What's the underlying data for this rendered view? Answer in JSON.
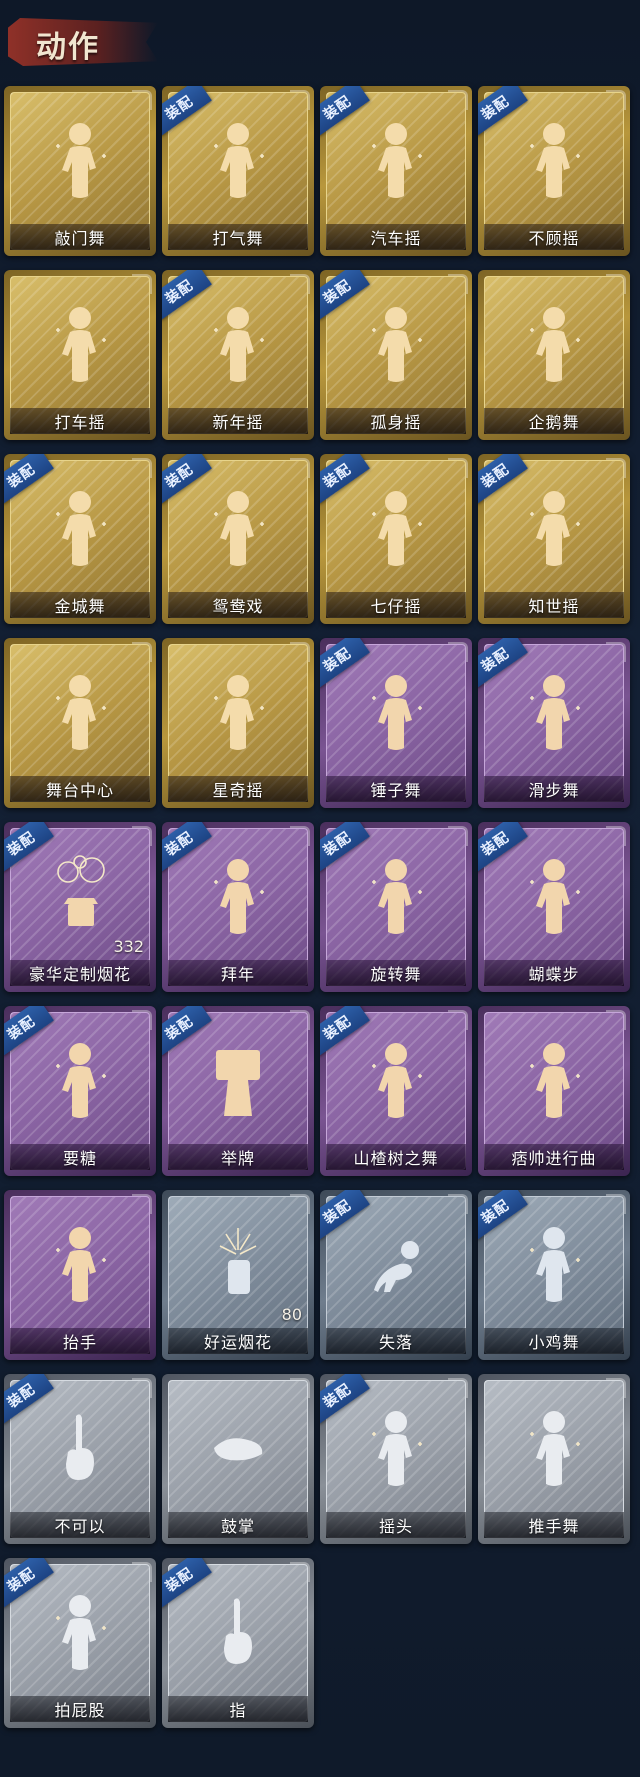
{
  "header": {
    "title": "动作"
  },
  "badge_label": "装配",
  "colors": {
    "gold": "#c9ad55",
    "purple": "#8a64a3",
    "silver": "#7f8c9b",
    "gray": "#9aa0a9",
    "badge": "#2d5fa8"
  },
  "items": [
    {
      "name": "敲门舞",
      "rarity": "gold",
      "equipped": false,
      "icon": "dance-figure-icon"
    },
    {
      "name": "打气舞",
      "rarity": "gold",
      "equipped": true,
      "icon": "dance-figure-icon"
    },
    {
      "name": "汽车摇",
      "rarity": "gold",
      "equipped": true,
      "icon": "dance-figure-icon"
    },
    {
      "name": "不顾摇",
      "rarity": "gold",
      "equipped": true,
      "icon": "dance-figure-icon"
    },
    {
      "name": "打车摇",
      "rarity": "gold",
      "equipped": false,
      "icon": "dance-figure-icon"
    },
    {
      "name": "新年摇",
      "rarity": "gold",
      "equipped": true,
      "icon": "dance-figure-icon"
    },
    {
      "name": "孤身摇",
      "rarity": "gold",
      "equipped": true,
      "icon": "dance-figure-icon"
    },
    {
      "name": "企鹅舞",
      "rarity": "gold",
      "equipped": false,
      "icon": "dance-figure-icon"
    },
    {
      "name": "金城舞",
      "rarity": "gold",
      "equipped": true,
      "icon": "dance-figure-icon"
    },
    {
      "name": "鸳鸯戏",
      "rarity": "gold",
      "equipped": true,
      "icon": "dance-figure-icon"
    },
    {
      "name": "七仔摇",
      "rarity": "gold",
      "equipped": true,
      "icon": "dance-figure-icon"
    },
    {
      "name": "知世摇",
      "rarity": "gold",
      "equipped": true,
      "icon": "dance-figure-icon"
    },
    {
      "name": "舞台中心",
      "rarity": "gold",
      "equipped": false,
      "icon": "dance-figure-icon"
    },
    {
      "name": "星奇摇",
      "rarity": "gold",
      "equipped": false,
      "icon": "dance-figure-icon"
    },
    {
      "name": "锤子舞",
      "rarity": "purple",
      "equipped": true,
      "icon": "dance-figure-icon"
    },
    {
      "name": "滑步舞",
      "rarity": "purple",
      "equipped": true,
      "icon": "dance-figure-icon"
    },
    {
      "name": "豪华定制烟花",
      "rarity": "purple",
      "equipped": true,
      "icon": "fireworks-box-icon",
      "count": "332"
    },
    {
      "name": "拜年",
      "rarity": "purple",
      "equipped": true,
      "icon": "bow-figure-icon"
    },
    {
      "name": "旋转舞",
      "rarity": "purple",
      "equipped": true,
      "icon": "spin-figure-icon"
    },
    {
      "name": "蝴蝶步",
      "rarity": "purple",
      "equipped": true,
      "icon": "dance-figure-icon"
    },
    {
      "name": "要糖",
      "rarity": "purple",
      "equipped": true,
      "icon": "dance-figure-icon"
    },
    {
      "name": "举牌",
      "rarity": "purple",
      "equipped": true,
      "icon": "sign-figure-icon"
    },
    {
      "name": "山楂树之舞",
      "rarity": "purple",
      "equipped": true,
      "icon": "dance-figure-icon"
    },
    {
      "name": "痞帅进行曲",
      "rarity": "purple",
      "equipped": false,
      "icon": "dance-figure-icon"
    },
    {
      "name": "抬手",
      "rarity": "purple",
      "equipped": false,
      "icon": "dance-figure-icon"
    },
    {
      "name": "好运烟花",
      "rarity": "silver",
      "equipped": false,
      "icon": "firecracker-icon",
      "count": "80"
    },
    {
      "name": "失落",
      "rarity": "silver",
      "equipped": true,
      "icon": "crawl-figure-icon"
    },
    {
      "name": "小鸡舞",
      "rarity": "silver",
      "equipped": true,
      "icon": "dance-figure-icon"
    },
    {
      "name": "不可以",
      "rarity": "gray",
      "equipped": true,
      "icon": "finger-wag-icon"
    },
    {
      "name": "鼓掌",
      "rarity": "gray",
      "equipped": false,
      "icon": "clap-hands-icon"
    },
    {
      "name": "摇头",
      "rarity": "gray",
      "equipped": true,
      "icon": "dance-figure-icon"
    },
    {
      "name": "推手舞",
      "rarity": "gray",
      "equipped": false,
      "icon": "dance-figure-icon"
    },
    {
      "name": "拍屁股",
      "rarity": "gray",
      "equipped": true,
      "icon": "dance-figure-icon"
    },
    {
      "name": "指",
      "rarity": "gray",
      "equipped": true,
      "icon": "point-hand-icon"
    }
  ]
}
